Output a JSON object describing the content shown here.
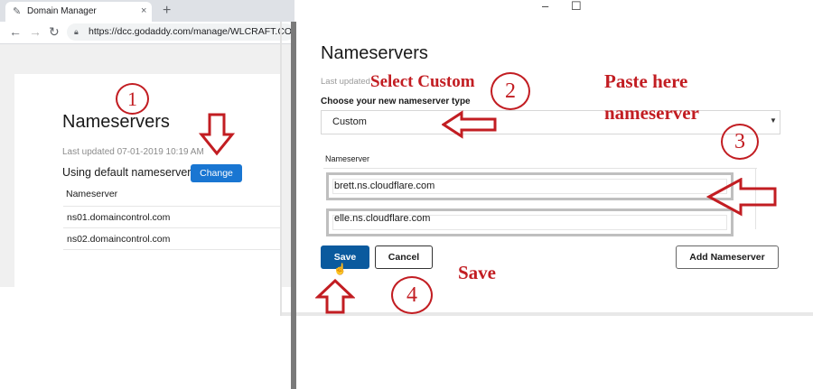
{
  "browser": {
    "tab_title": "Domain Manager",
    "tab_close": "×",
    "new_tab": "+",
    "url": "https://dcc.godaddy.com/manage/WLCRAFT.COM",
    "window_controls": [
      "–",
      "☐"
    ]
  },
  "left_panel": {
    "title": "Nameservers",
    "last_updated": "Last updated 07-01-2019 10:19 AM",
    "using_default": "Using default nameservers",
    "change_button": "Change",
    "nameserver_header": "Nameserver",
    "nameservers": [
      "ns01.domaincontrol.com",
      "ns02.domaincontrol.com"
    ]
  },
  "right_panel": {
    "title": "Nameservers",
    "last_updated_partial": "Last updated",
    "choose_label": "Choose your new nameserver type",
    "selected_type": "Custom",
    "nameserver_header": "Nameserver",
    "nameserver_inputs": [
      "brett.ns.cloudflare.com",
      "elle.ns.cloudflare.com"
    ],
    "save_button": "Save",
    "cancel_button": "Cancel",
    "add_button": "Add Nameserver"
  },
  "annotations": {
    "step1": "1",
    "step2": "2",
    "step3": "3",
    "step4": "4",
    "select_custom": "Select Custom",
    "paste_here_line1": "Paste here",
    "paste_here_line2": "nameserver",
    "save_label": "Save",
    "color": "#c21d22"
  },
  "colors": {
    "change_button": "#1976d2",
    "save_button": "#0a5a9e",
    "divider": "#7a7a7a"
  }
}
